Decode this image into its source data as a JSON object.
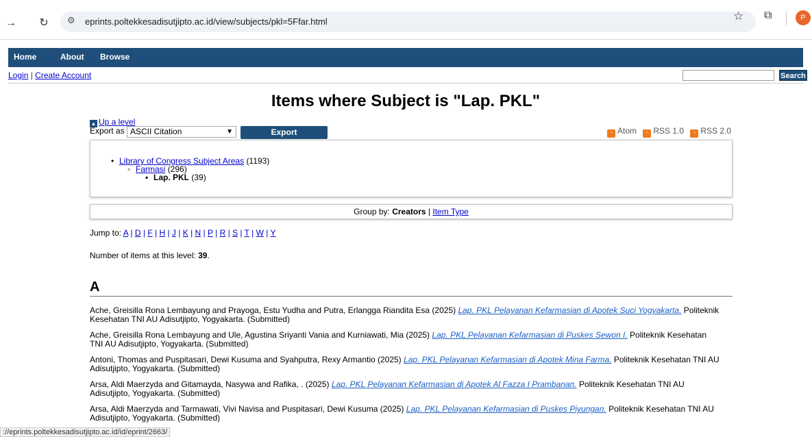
{
  "browser": {
    "url": "eprints.poltekkesadisutjipto.ac.id/view/subjects/pkl=5Ffar.html",
    "profile_initial": "P",
    "status_url": "://eprints.poltekkesadisutjipto.ac.id/id/eprint/2663/"
  },
  "menu": {
    "home": "Home",
    "about": "About",
    "browse": "Browse"
  },
  "account": {
    "login": "Login",
    "sep": "|",
    "create": "Create Account",
    "search_label": "Search"
  },
  "page": {
    "title": "Items where Subject is \"Lap. PKL\"",
    "up_level": "Up a level",
    "export_label": "Export as",
    "export_format": "ASCII Citation",
    "export_button": "Export",
    "feeds": {
      "atom": "Atom",
      "rss1": "RSS 1.0",
      "rss2": "RSS 2.0"
    }
  },
  "tree": {
    "root": {
      "label": "Library of Congress Subject Areas",
      "count": "(1193)"
    },
    "child": {
      "label": "Farmasi",
      "count": "(296)"
    },
    "leaf": {
      "label": "Lap. PKL",
      "count": "(39)"
    }
  },
  "group": {
    "label": "Group by:",
    "creators": "Creators",
    "sep": "|",
    "item_type": "Item Type"
  },
  "jump": {
    "label": "Jump to:",
    "letters": [
      "A",
      "D",
      "F",
      "H",
      "J",
      "K",
      "N",
      "P",
      "R",
      "S",
      "T",
      "W",
      "Y"
    ]
  },
  "count": {
    "label": "Number of items at this level:",
    "value": "39",
    "end": "."
  },
  "section": "A",
  "entries": [
    {
      "authors": "Ache, Greisilla Rona Lembayung and Prayoga, Estu Yudha and Putra, Erlangga Riandita Esa (2025)",
      "title": "Lap. PKL Pelayanan Kefarmasian di Apotek Suci Yogyakarta.",
      "publisher": "Politeknik Kesehatan TNI AU Adisutjipto, Yogyakarta. (Submitted)"
    },
    {
      "authors": "Ache, Greisilla Rona Lembayung and Ule, Agustina Sriyanti Vania and Kurniawati, Mia (2025)",
      "title": "Lap. PKL Pelayanan Kefarmasian di Puskes Sewon I.",
      "publisher": "Politeknik Kesehatan TNI AU Adisutjipto, Yogyakarta. (Submitted)"
    },
    {
      "authors": "Antoni, Thomas and Puspitasari, Dewi Kusuma and Syahputra, Rexy Armantio (2025)",
      "title": "Lap. PKL Pelayanan Kefarmasian di Apotek Mina Farma.",
      "publisher": "Politeknik Kesehatan TNI AU Adisutjipto, Yogyakarta. (Submitted)"
    },
    {
      "authors": "Arsa, Aldi Maerzyda and Gitamayda, Nasywa and Rafika, . (2025)",
      "title": "Lap. PKL Pelayanan Kefarmasian di Apotek Al Fazza I Prambanan.",
      "publisher": "Politeknik Kesehatan TNI AU Adisutjipto, Yogyakarta. (Submitted)"
    },
    {
      "authors": "Arsa, Aldi Maerzyda and Tarmawati, Vivi Navisa and Puspitasari, Dewi Kusuma (2025)",
      "title": "Lap. PKL Pelayanan Kefarmasian di Puskes Piyungan.",
      "publisher": "Politeknik Kesehatan TNI AU Adisutjipto, Yogyakarta. (Submitted)"
    }
  ]
}
